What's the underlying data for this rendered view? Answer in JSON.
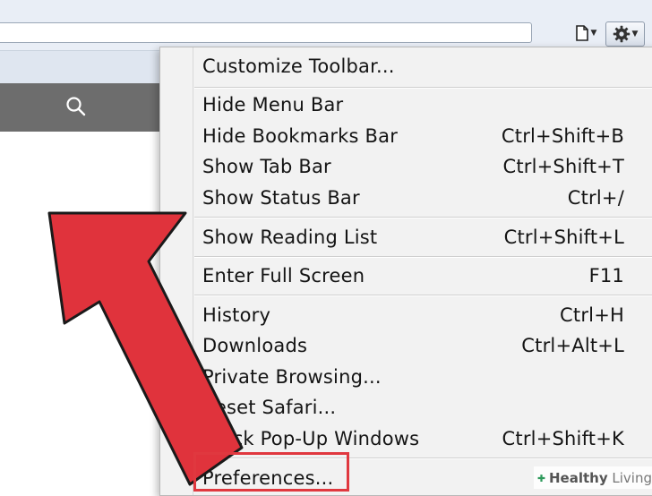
{
  "toolbar": {
    "page_button_icon": "page-icon",
    "gear_button_icon": "gear-icon",
    "search_icon": "search-icon"
  },
  "menu": {
    "items": [
      {
        "label": "Customize Toolbar...",
        "shortcut": ""
      },
      {
        "label": "Hide Menu Bar",
        "shortcut": ""
      },
      {
        "label": "Hide Bookmarks Bar",
        "shortcut": "Ctrl+Shift+B"
      },
      {
        "label": "Show Tab Bar",
        "shortcut": "Ctrl+Shift+T"
      },
      {
        "label": "Show Status Bar",
        "shortcut": "Ctrl+/"
      },
      {
        "label": "Show Reading List",
        "shortcut": "Ctrl+Shift+L"
      },
      {
        "label": "Enter Full Screen",
        "shortcut": "F11"
      },
      {
        "label": "History",
        "shortcut": "Ctrl+H"
      },
      {
        "label": "Downloads",
        "shortcut": "Ctrl+Alt+L"
      },
      {
        "label": "Private Browsing...",
        "shortcut": ""
      },
      {
        "label": "Reset Safari...",
        "shortcut": ""
      },
      {
        "label": "Block Pop-Up Windows",
        "shortcut": "Ctrl+Shift+K",
        "checked": true
      },
      {
        "label": "Preferences...",
        "shortcut": ""
      }
    ]
  },
  "annotation": {
    "arrow_color": "#e0333c",
    "highlight_color": "#e0383f"
  },
  "watermark": {
    "brand_bold": "Healthy",
    "brand_rest": " Living"
  }
}
